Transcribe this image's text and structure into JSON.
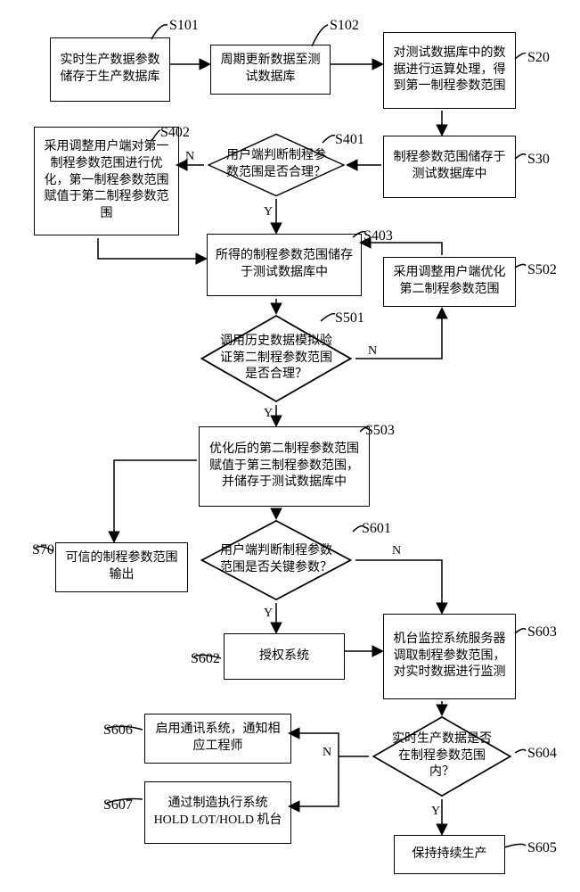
{
  "chart_data": {
    "type": "flowchart",
    "nodes": [
      {
        "id": "S101",
        "type": "process",
        "text": "实时生产数据参数储存于生产数据库"
      },
      {
        "id": "S102",
        "type": "process",
        "text": "周期更新数据至测试数据库"
      },
      {
        "id": "S20",
        "type": "process",
        "text": "对测试数据库中的数据进行运算处理，得到第一制程参数范围"
      },
      {
        "id": "S30",
        "type": "process",
        "text": "制程参数范围储存于测试数据库中"
      },
      {
        "id": "S401",
        "type": "decision",
        "text": "用户端判断制程参数范围是否合理？"
      },
      {
        "id": "S402",
        "type": "process",
        "text": "采用调整用户端对第一制程参数范围进行优化，第一制程参数范围赋值于第二制程参数范围"
      },
      {
        "id": "S403",
        "type": "process",
        "text": "所得的制程参数范围储存于测试数据库中"
      },
      {
        "id": "S501",
        "type": "decision",
        "text": "调用历史数据模拟验证第二制程参数范围是否合理？"
      },
      {
        "id": "S502",
        "type": "process",
        "text": "采用调整用户端优化第二制程参数范围"
      },
      {
        "id": "S503",
        "type": "process",
        "text": "优化后的第二制程参数范围赋值于第三制程参数范围，并储存于测试数据库中"
      },
      {
        "id": "S601",
        "type": "decision",
        "text": "用户端判断制程参数范围是否关键参数？"
      },
      {
        "id": "S70",
        "type": "process",
        "text": "可信的制程参数范围输出"
      },
      {
        "id": "S602",
        "type": "process",
        "text": "授权系统"
      },
      {
        "id": "S603",
        "type": "process",
        "text": "机台监控系统服务器调取制程参数范围，对实时数据进行监测"
      },
      {
        "id": "S604",
        "type": "decision",
        "text": "实时生产数据是否在制程参数范围内？"
      },
      {
        "id": "S605",
        "type": "process",
        "text": "保持持续生产"
      },
      {
        "id": "S606",
        "type": "process",
        "text": "启用通讯系统，通知相应工程师"
      },
      {
        "id": "S607",
        "type": "process",
        "text": "通过制造执行系统HOLD LOT/HOLD 机台"
      }
    ],
    "edges": [
      {
        "from": "S101",
        "to": "S102"
      },
      {
        "from": "S102",
        "to": "S20"
      },
      {
        "from": "S20",
        "to": "S30"
      },
      {
        "from": "S30",
        "to": "S401"
      },
      {
        "from": "S401",
        "to": "S402",
        "label": "N"
      },
      {
        "from": "S401",
        "to": "S403",
        "label": "Y"
      },
      {
        "from": "S402",
        "to": "S403"
      },
      {
        "from": "S403",
        "to": "S501"
      },
      {
        "from": "S501",
        "to": "S502",
        "label": "N"
      },
      {
        "from": "S502",
        "to": "S403"
      },
      {
        "from": "S501",
        "to": "S503",
        "label": "Y"
      },
      {
        "from": "S503",
        "to": "S601"
      },
      {
        "from": "S503",
        "to": "S70"
      },
      {
        "from": "S601",
        "to": "S602",
        "label": "Y"
      },
      {
        "from": "S601",
        "to": "S603",
        "label": "N"
      },
      {
        "from": "S602",
        "to": "S603"
      },
      {
        "from": "S603",
        "to": "S604"
      },
      {
        "from": "S604",
        "to": "S605",
        "label": "Y"
      },
      {
        "from": "S604",
        "to": "S606",
        "label": "N"
      },
      {
        "from": "S604",
        "to": "S607",
        "label": "N"
      }
    ]
  },
  "nodes": {
    "S101": "实时生产数据参数储存于生产数据库",
    "S102": "周期更新数据至测试数据库",
    "S20": "对测试数据库中的数据进行运算处理，得到第一制程参数范围",
    "S30": "制程参数范围储存于测试数据库中",
    "S401": "用户端判断制程参数范围是否合理？",
    "S402": "采用调整用户端对第一制程参数范围进行优化，第一制程参数范围赋值于第二制程参数范围",
    "S403": "所得的制程参数范围储存于测试数据库中",
    "S501": "调用历史数据模拟验证第二制程参数范围是否合理？",
    "S502": "采用调整用户端优化第二制程参数范围",
    "S503": "优化后的第二制程参数范围赋值于第三制程参数范围，并储存于测试数据库中",
    "S601": "用户端判断制程参数范围是否关键参数？",
    "S70": "可信的制程参数范围输出",
    "S602": "授权系统",
    "S603": "机台监控系统服务器调取制程参数范围，对实时数据进行监测",
    "S604": "实时生产数据是否在制程参数范围内？",
    "S605": "保持持续生产",
    "S606": "启用通讯系统，通知相应工程师",
    "S607": "通过制造执行系统HOLD LOT/HOLD 机台"
  },
  "labels": {
    "S101": "S101",
    "S102": "S102",
    "S20": "S20",
    "S30": "S30",
    "S401": "S401",
    "S402": "S402",
    "S403": "S403",
    "S501": "S501",
    "S502": "S502",
    "S503": "S503",
    "S601": "S601",
    "S70": "S70",
    "S602": "S602",
    "S603": "S603",
    "S604": "S604",
    "S605": "S605",
    "S606": "S606",
    "S607": "S607"
  },
  "yn": {
    "Y": "Y",
    "N": "N"
  }
}
